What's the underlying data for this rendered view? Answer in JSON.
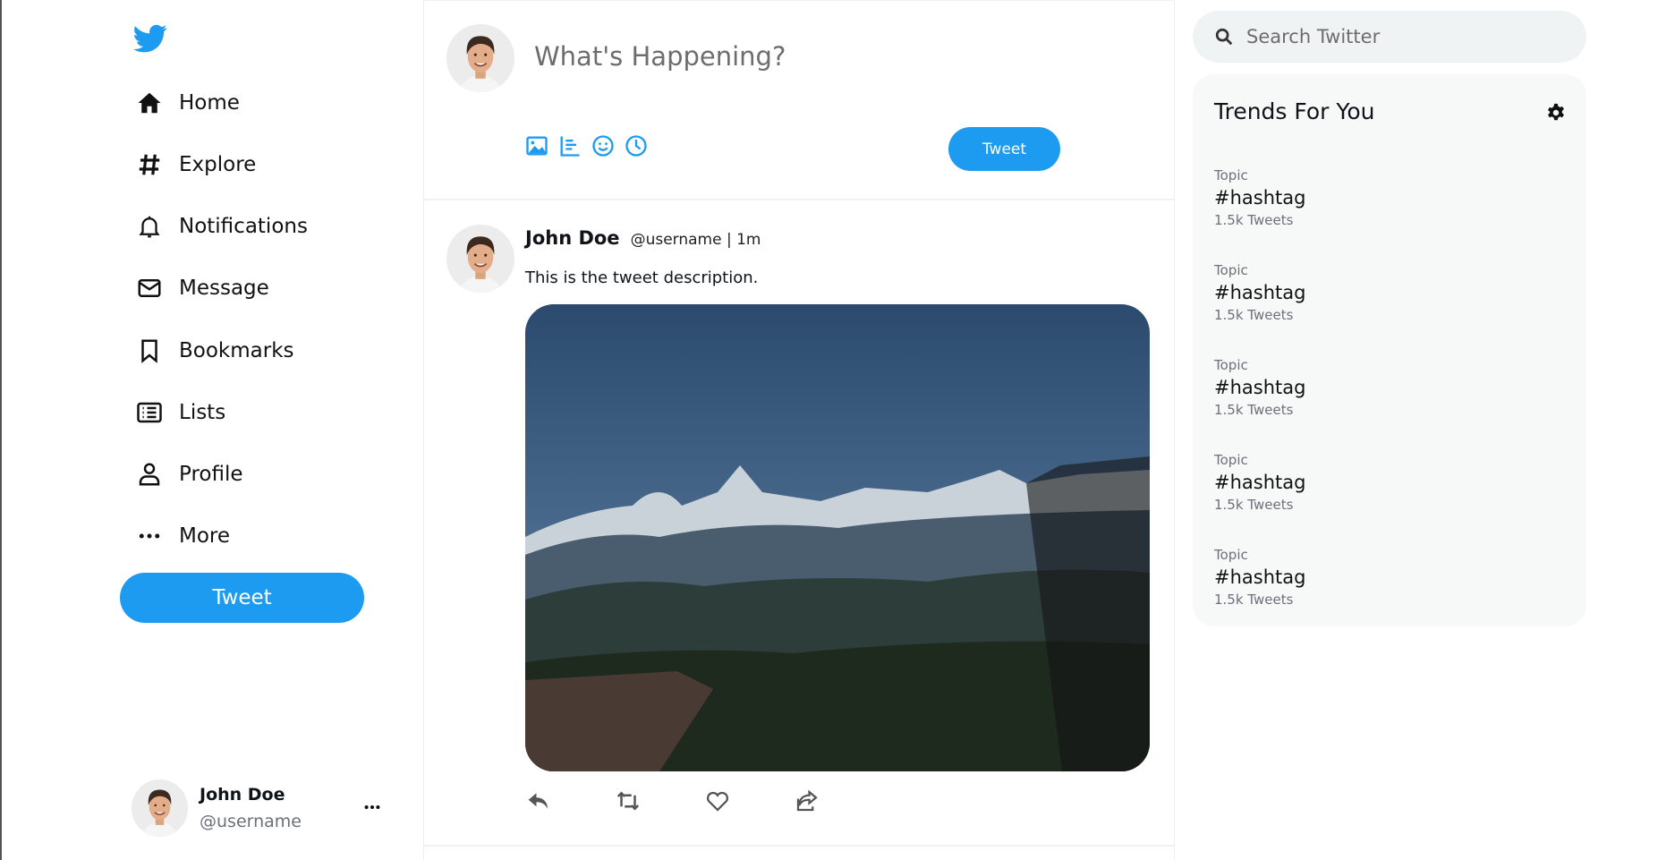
{
  "sidebar": {
    "logo": "twitter-bird-icon",
    "items": [
      {
        "label": "Home",
        "icon": "home-icon"
      },
      {
        "label": "Explore",
        "icon": "hashtag-icon"
      },
      {
        "label": "Notifications",
        "icon": "bell-icon"
      },
      {
        "label": "Message",
        "icon": "envelope-icon"
      },
      {
        "label": "Bookmarks",
        "icon": "bookmark-icon"
      },
      {
        "label": "Lists",
        "icon": "list-icon"
      },
      {
        "label": "Profile",
        "icon": "user-icon"
      },
      {
        "label": "More",
        "icon": "ellipsis-icon"
      }
    ],
    "tweet_label": "Tweet",
    "profile": {
      "name": "John Doe",
      "handle": "@username"
    }
  },
  "composer": {
    "placeholder": "What's Happening?",
    "tools": [
      "image-icon",
      "poll-icon",
      "emoji-icon",
      "schedule-icon"
    ],
    "tweet_label": "Tweet"
  },
  "feed": [
    {
      "name": "John Doe",
      "meta": "@username | 1m",
      "text": "This is the tweet description.",
      "actions": [
        "reply-icon",
        "retweet-icon",
        "like-icon",
        "share-icon"
      ]
    }
  ],
  "right": {
    "search_placeholder": "Search Twitter",
    "trends_title": "Trends For You",
    "trends": [
      {
        "topic": "Topic",
        "tag": "#hashtag",
        "count": "1.5k Tweets"
      },
      {
        "topic": "Topic",
        "tag": "#hashtag",
        "count": "1.5k Tweets"
      },
      {
        "topic": "Topic",
        "tag": "#hashtag",
        "count": "1.5k Tweets"
      },
      {
        "topic": "Topic",
        "tag": "#hashtag",
        "count": "1.5k Tweets"
      },
      {
        "topic": "Topic",
        "tag": "#hashtag",
        "count": "1.5k Tweets"
      }
    ]
  },
  "colors": {
    "accent": "#1d9bf0",
    "search_bg": "#eff3f4",
    "card_bg": "#f7f9f9"
  }
}
